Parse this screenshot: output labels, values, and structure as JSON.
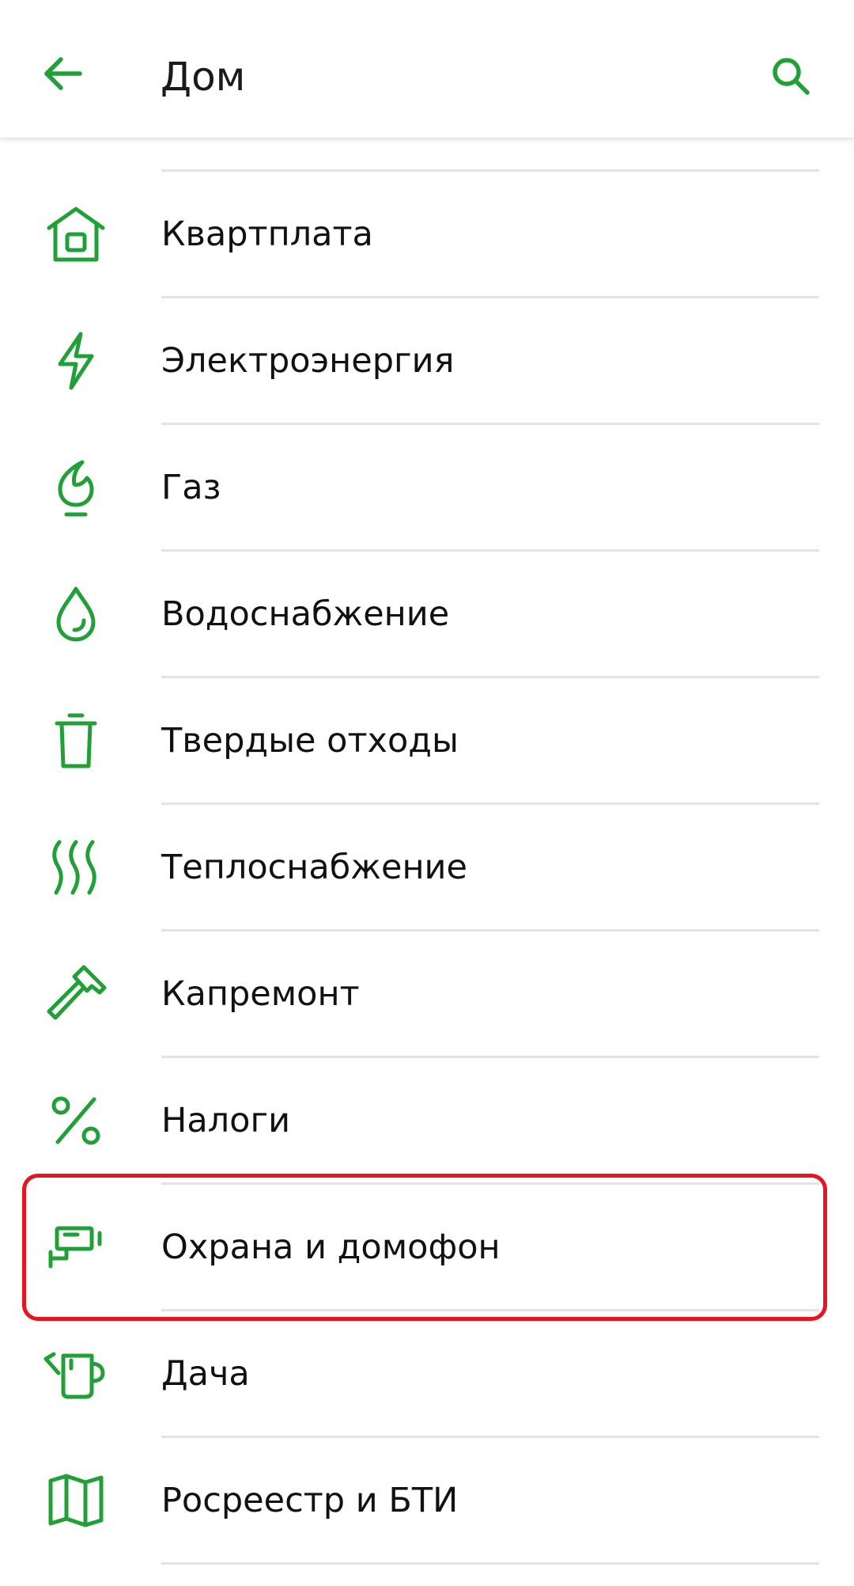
{
  "colors": {
    "accent": "#21a038",
    "highlight": "#e8141f",
    "divider": "#e3e3e3"
  },
  "header": {
    "title": "Дом",
    "back_icon": "arrow-left-icon",
    "search_icon": "search-icon"
  },
  "items": [
    {
      "label": "Квартплата",
      "icon": "house-icon"
    },
    {
      "label": "Электроэнергия",
      "icon": "lightning-icon"
    },
    {
      "label": "Газ",
      "icon": "gas-flame-icon"
    },
    {
      "label": "Водоснабжение",
      "icon": "water-drop-icon"
    },
    {
      "label": "Твердые отходы",
      "icon": "trash-can-icon"
    },
    {
      "label": "Теплоснабжение",
      "icon": "heat-waves-icon"
    },
    {
      "label": "Капремонт",
      "icon": "hammer-icon"
    },
    {
      "label": "Налоги",
      "icon": "percent-icon"
    },
    {
      "label": "Охрана и домофон",
      "icon": "security-camera-icon"
    },
    {
      "label": "Дача",
      "icon": "watering-can-icon"
    },
    {
      "label": "Росреестр и БТИ",
      "icon": "map-icon"
    }
  ]
}
